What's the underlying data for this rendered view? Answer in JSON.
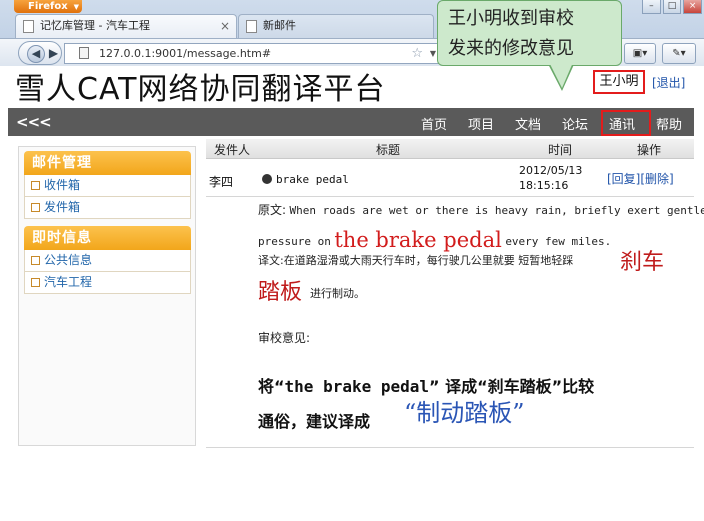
{
  "browser": {
    "app_button": "Firefox",
    "tabs": [
      {
        "title": "记忆库管理 - 汽车工程"
      },
      {
        "title": "新邮件"
      }
    ],
    "new_tab": "+",
    "url": "127.0.0.1:9001/message.htm#"
  },
  "callout": {
    "line1": "王小明收到审校",
    "line2": "发来的修改意见"
  },
  "site": {
    "title": "雪人CAT网络协同翻译平台",
    "user": "王小明",
    "logout": "[退出]"
  },
  "nav": {
    "collapse": "<<<",
    "items": [
      "首页",
      "项目",
      "文档",
      "论坛",
      "通讯",
      "帮助"
    ],
    "active": "通讯"
  },
  "sidebar": {
    "groups": [
      {
        "title": "邮件管理",
        "items": [
          "收件箱",
          "发件箱"
        ]
      },
      {
        "title": "即时信息",
        "items": [
          "公共信息",
          "汽车工程"
        ]
      }
    ]
  },
  "table": {
    "headers": {
      "sender": "发件人",
      "subject": "标题",
      "time": "时间",
      "action": "操作"
    },
    "row": {
      "sender": "李四",
      "subject": "brake pedal",
      "date": "2012/05/13",
      "time": "18:15:16",
      "reply": "[回复]",
      "delete": "[删除]"
    }
  },
  "message": {
    "original_label": "原文:",
    "original_1": "When roads are wet or there is heavy rain, briefly exert gentle",
    "original_2a": "pressure on",
    "original_term": "the brake pedal",
    "original_2b": "every few miles.",
    "translation_label": "译文:",
    "translation_1": "在道路湿滑或大雨天行车时，每行驶几公里就要 短暂地轻踩",
    "translation_term_1": "刹车",
    "translation_term_2": "踏板",
    "translation_2": "进行制动。",
    "review_label": "审校意见:",
    "review_1a": "将“",
    "review_1_term": "the brake pedal",
    "review_1b": "” 译成“刹车踏板”比较",
    "review_2": "通俗，建议译成",
    "review_term": "“制动踏板”"
  }
}
